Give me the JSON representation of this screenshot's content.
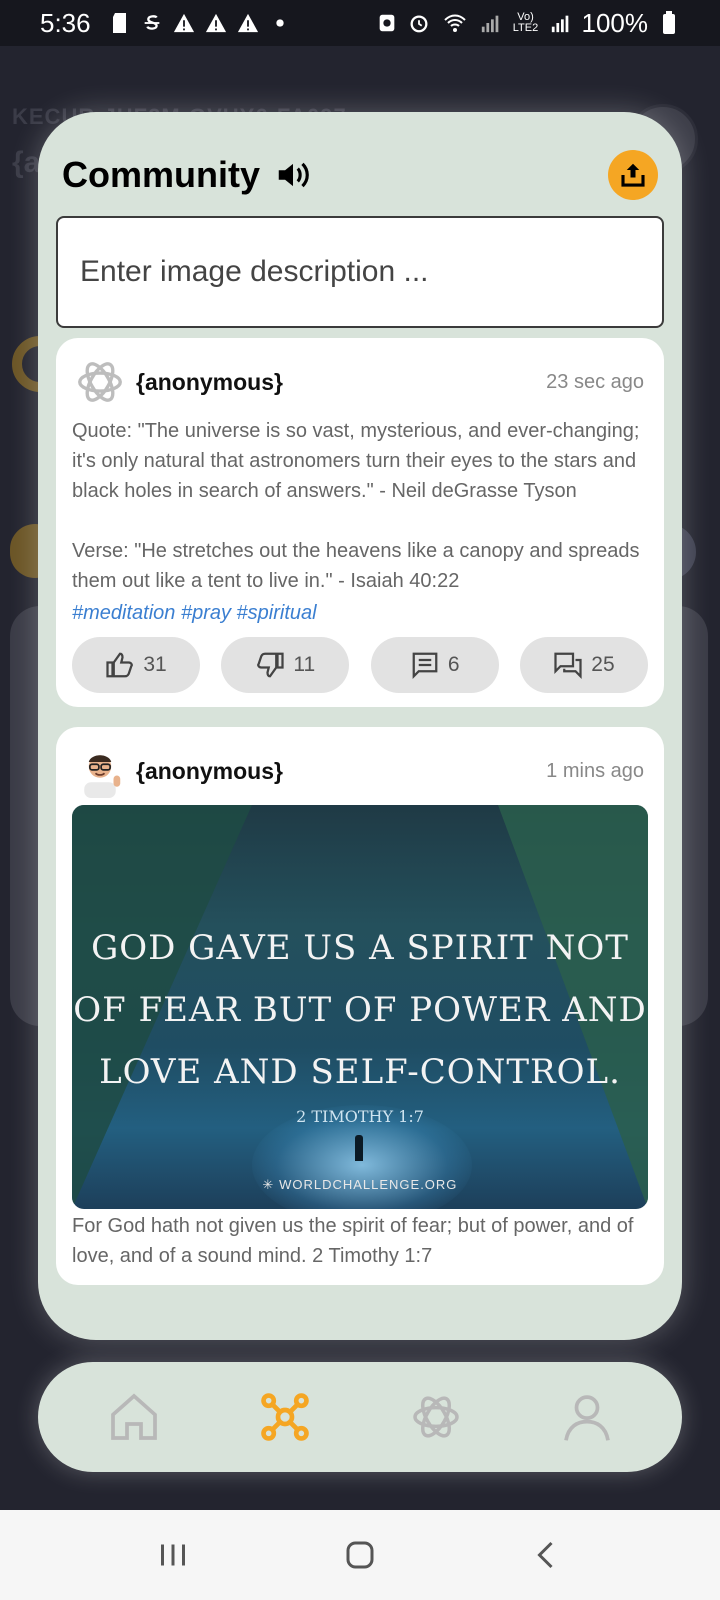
{
  "status_bar": {
    "time": "5:36",
    "battery": "100%",
    "network_label": "Vo) LTE2"
  },
  "background": {
    "code_fragment": "KECUR-JHF2M-GVUY6-FA097",
    "user_fragment": "{a"
  },
  "community": {
    "title": "Community",
    "input_placeholder": "Enter image description ...",
    "accent_color": "#f5a623",
    "posts": [
      {
        "author": "{anonymous}",
        "avatar_icon": "openai-logo-icon",
        "time": "23 sec ago",
        "quote": "Quote: \"The universe is so vast, mysterious, and ever-changing; it's only natural that astronomers turn their eyes to the stars and black holes in search of answers.\" - Neil deGrasse Tyson",
        "verse": "Verse: \"He stretches out the heavens like a canopy and spreads them out like a tent to live in.\" - Isaiah 40:22",
        "tags": "#meditation #pray #spiritual",
        "likes": "31",
        "dislikes": "11",
        "comments": "6",
        "shares": "25"
      },
      {
        "author": "{anonymous}",
        "avatar_icon": "memoji-avatar-icon",
        "time": "1 mins ago",
        "image_quote_line1": "GOD GAVE US A SPIRIT NOT",
        "image_quote_line2": "OF FEAR BUT OF POWER AND",
        "image_quote_line3": "LOVE AND SELF-CONTROL.",
        "image_reference": "2 TIMOTHY 1:7",
        "image_site": "WORLDCHALLENGE.ORG",
        "caption": "For God hath not given us the spirit of fear; but of power, and of love, and of a sound mind. 2 Timothy 1:7"
      }
    ]
  },
  "bottom_nav": {
    "items": [
      "home-icon",
      "community-network-icon",
      "openai-logo-icon",
      "profile-icon"
    ],
    "active": "community-network-icon",
    "active_color": "#f5a623"
  }
}
